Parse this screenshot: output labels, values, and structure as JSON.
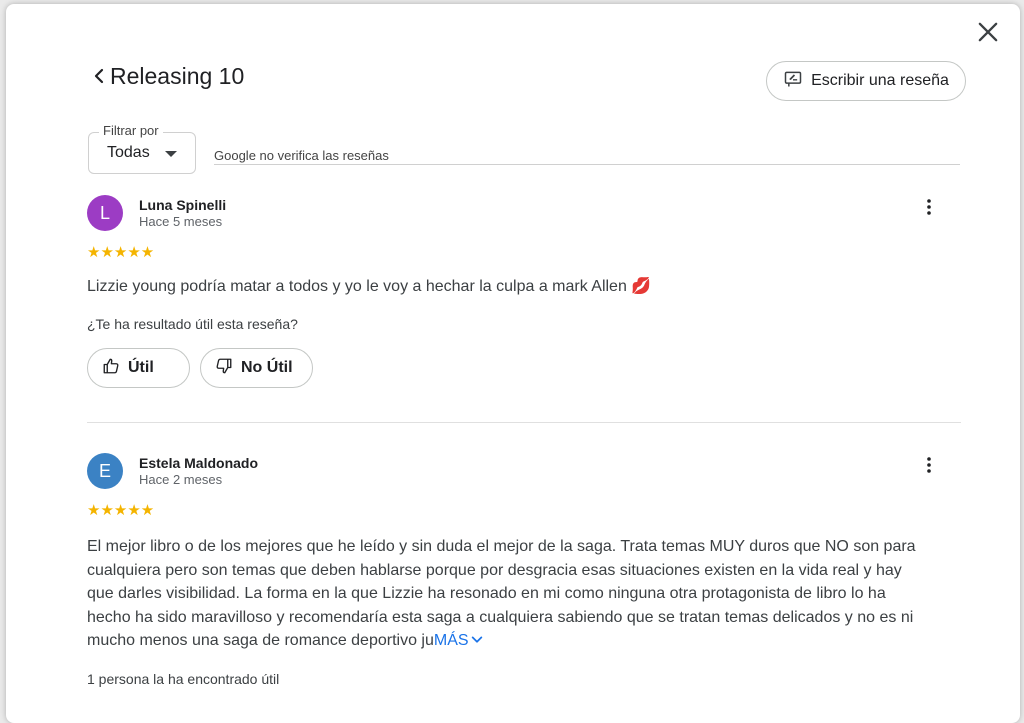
{
  "header": {
    "title": "Releasing 10",
    "write_review_label": "Escribir una reseña"
  },
  "filter": {
    "legend": "Filtrar por",
    "selected": "Todas",
    "disclaimer": "Google no verifica las reseñas"
  },
  "reviews": [
    {
      "initial": "L",
      "avatar_color": "#9c3cc4",
      "author": "Luna Spinelli",
      "time": "Hace 5 meses",
      "stars": "★★★★★",
      "text": "Lizzie young podría matar a todos y yo le voy a hechar la culpa a mark Allen 💋",
      "helpful_question": "¿Te ha resultado útil esta reseña?",
      "useful_label": "Útil",
      "not_useful_label": "No Útil"
    },
    {
      "initial": "E",
      "avatar_color": "#3b82c4",
      "author": "Estela Maldonado",
      "time": "Hace 2 meses",
      "stars": "★★★★★",
      "text": "El mejor libro o de los mejores que he leído y sin duda el mejor de la saga. Trata temas MUY duros que NO son para cualquiera pero son temas que deben hablarse porque por desgracia esas situaciones existen en la vida real y hay que darles visibilidad. La forma en la que Lizzie ha resonado en mi como ninguna otra protagonista de libro lo ha hecho ha sido maravilloso y recomendaría esta saga a cualquiera sabiendo que se tratan temas delicados y no es ni mucho menos una saga de romance deportivo ju",
      "more_label": "MÁS",
      "found_useful": "1 persona la ha encontrado útil"
    }
  ]
}
